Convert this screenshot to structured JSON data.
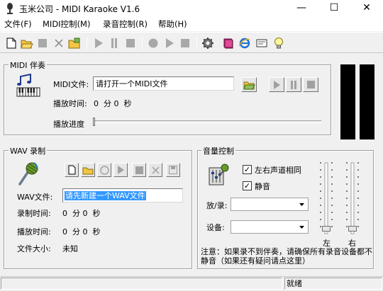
{
  "window": {
    "title": "玉米公司 - MIDI Karaoke V1.6",
    "minimize": "—",
    "maximize": "☐",
    "close": "✕"
  },
  "menu": [
    {
      "label": "文件",
      "key": "(F)"
    },
    {
      "label": "MIDI控制",
      "key": "(M)"
    },
    {
      "label": "录音控制",
      "key": "(R)"
    },
    {
      "label": "帮助",
      "key": "(H)"
    }
  ],
  "toolbar_icons": [
    "new-file-icon",
    "open-folder-icon",
    "stop-icon",
    "delete-icon",
    "import-icon",
    "play-icon",
    "pause-icon",
    "stop-icon",
    "record-icon",
    "play-icon",
    "stop-icon",
    "settings-gear-icon",
    "book-icon",
    "internet-explorer-icon",
    "card-icon",
    "lightbulb-icon"
  ],
  "midi": {
    "group_label": "MIDI 伴奏",
    "file_label": "MIDI文件:",
    "file_value": "请打开一个MIDI文件",
    "play_time_label": "播放时间:",
    "play_time_value": "0  分 0  秒",
    "progress_label": "播放进度",
    "progress": 0
  },
  "wav": {
    "group_label": "WAV 录制",
    "file_label": "WAV文件:",
    "file_value": "请先新建一个WAV文件",
    "rec_time_label": "录制时间:",
    "rec_time_value": "0  分 0  秒",
    "play_time_label": "播放时间:",
    "play_time_value": "0  分 0  秒",
    "size_label": "文件大小:",
    "size_value": "未知"
  },
  "volume": {
    "group_label": "音量控制",
    "sync_label": "左右声道相同",
    "sync_checked": true,
    "mute_label": "静音",
    "mute_checked": true,
    "play_rec_label": "放/录:",
    "play_rec_value": "",
    "device_label": "设备:",
    "device_value": "",
    "left_label": "左",
    "right_label": "右",
    "left_level": 0,
    "right_level": 0,
    "note": "注意：如果录不到伴奏，请确保所有录音设备都不静音（如果还有疑问请点这里）"
  },
  "status": {
    "text": "就绪"
  },
  "colors": {
    "selection": "#3399ff",
    "meter": "#000000",
    "accent_green": "#6a9a2a"
  }
}
